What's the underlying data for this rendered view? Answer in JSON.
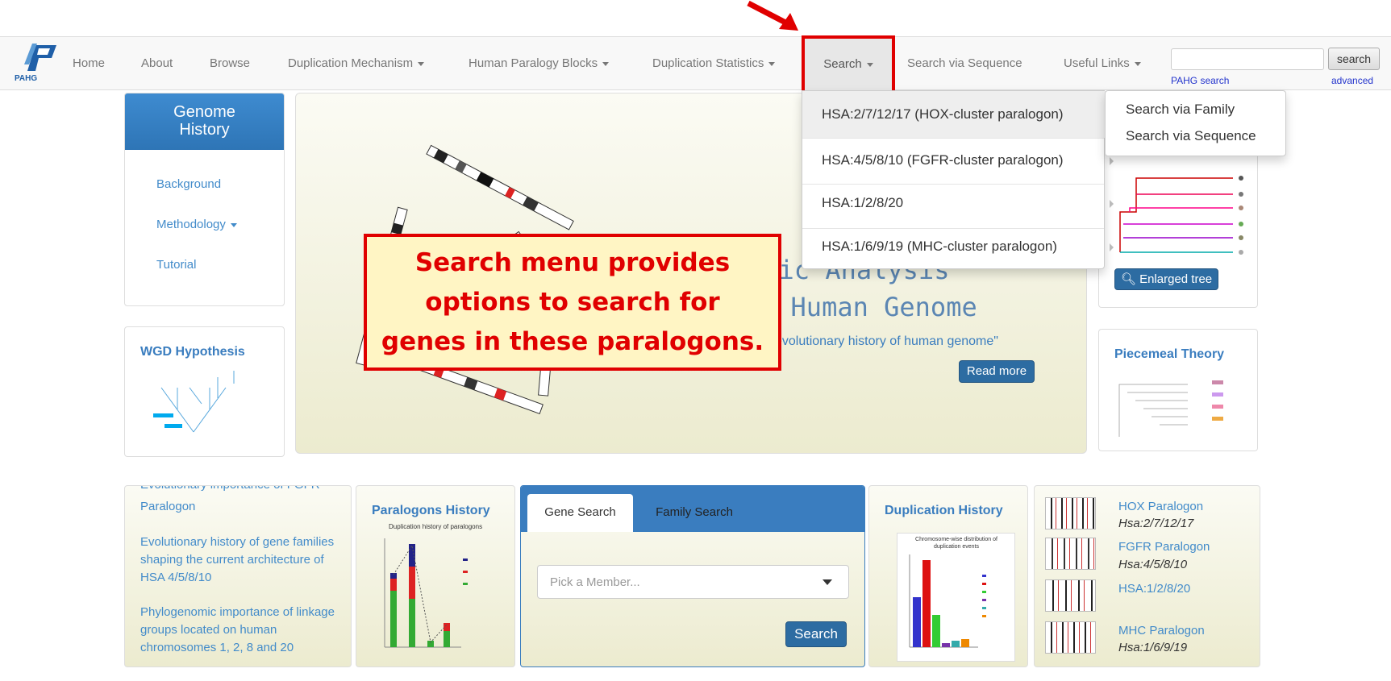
{
  "nav": {
    "logo_text": "PAHG",
    "home": "Home",
    "about": "About",
    "browse": "Browse",
    "duplication_mechanism": "Duplication Mechanism",
    "human_paralogy_blocks": "Human Paralogy Blocks",
    "duplication_statistics": "Duplication Statistics",
    "search": "Search",
    "search_via_sequence": "Search via Sequence",
    "useful_links": "Useful Links",
    "search_button": "search",
    "search_input_value": "",
    "pahg_search_link": "PAHG search",
    "advanced_link": "advanced"
  },
  "search_menu": {
    "items": [
      "HSA:2/7/12/17 (HOX-cluster paralogon)",
      "HSA:4/5/8/10 (FGFR-cluster paralogon)",
      "HSA:1/2/8/20",
      "HSA:1/6/9/19 (MHC-cluster paralogon)"
    ],
    "submenu": [
      "Search via Family",
      "Search via Sequence"
    ]
  },
  "sidebar": {
    "title": "Genome History",
    "links": [
      "Background",
      "Methodology",
      "Tutorial"
    ]
  },
  "wgd": {
    "title": "WGD Hypothesis"
  },
  "hero": {
    "line1_visible": "omic Analysis",
    "line2_visible": "f Human Genome",
    "quote": "evolutionary history of human genome\"",
    "read_more": "Read more"
  },
  "callout": {
    "text": "Search menu provides options to search for genes in these paralogons."
  },
  "tree_panel": {
    "enlarged_tree": "Enlarged tree"
  },
  "piecemeal": {
    "title": "Piecemeal Theory"
  },
  "news": {
    "cut_line": "Evolutionary importance of FGFR",
    "item1": "Paralogon",
    "item2": "Evolutionary history of gene families shaping the current architecture of HSA 4/5/8/10",
    "item3": "Phylogenomic importance of linkage groups located on human chromosomes 1, 2, 8 and 20"
  },
  "paralogons_history": {
    "title": "Paralogons History",
    "chart_caption": "Duplication history of paralogons"
  },
  "gene_search": {
    "tab_gene": "Gene Search",
    "tab_family": "Family Search",
    "placeholder": "Pick a Member...",
    "button": "Search"
  },
  "duplication_history": {
    "title": "Duplication History",
    "chart_caption": "Chromosome-wise distribution of duplication events"
  },
  "paralogons": [
    {
      "name": "HOX Paralogon",
      "hsa": "Hsa:2/7/12/17"
    },
    {
      "name": "FGFR Paralogon",
      "hsa": "Hsa:4/5/8/10"
    },
    {
      "name": "HSA:1/2/8/20",
      "hsa": ""
    },
    {
      "name": "MHC Paralogon",
      "hsa": "Hsa:1/6/9/19"
    }
  ],
  "colors": {
    "highlight": "#e00000",
    "link": "#428bca",
    "nav_blue": "#3a7dbf",
    "callout_bg": "#fff5c4"
  }
}
